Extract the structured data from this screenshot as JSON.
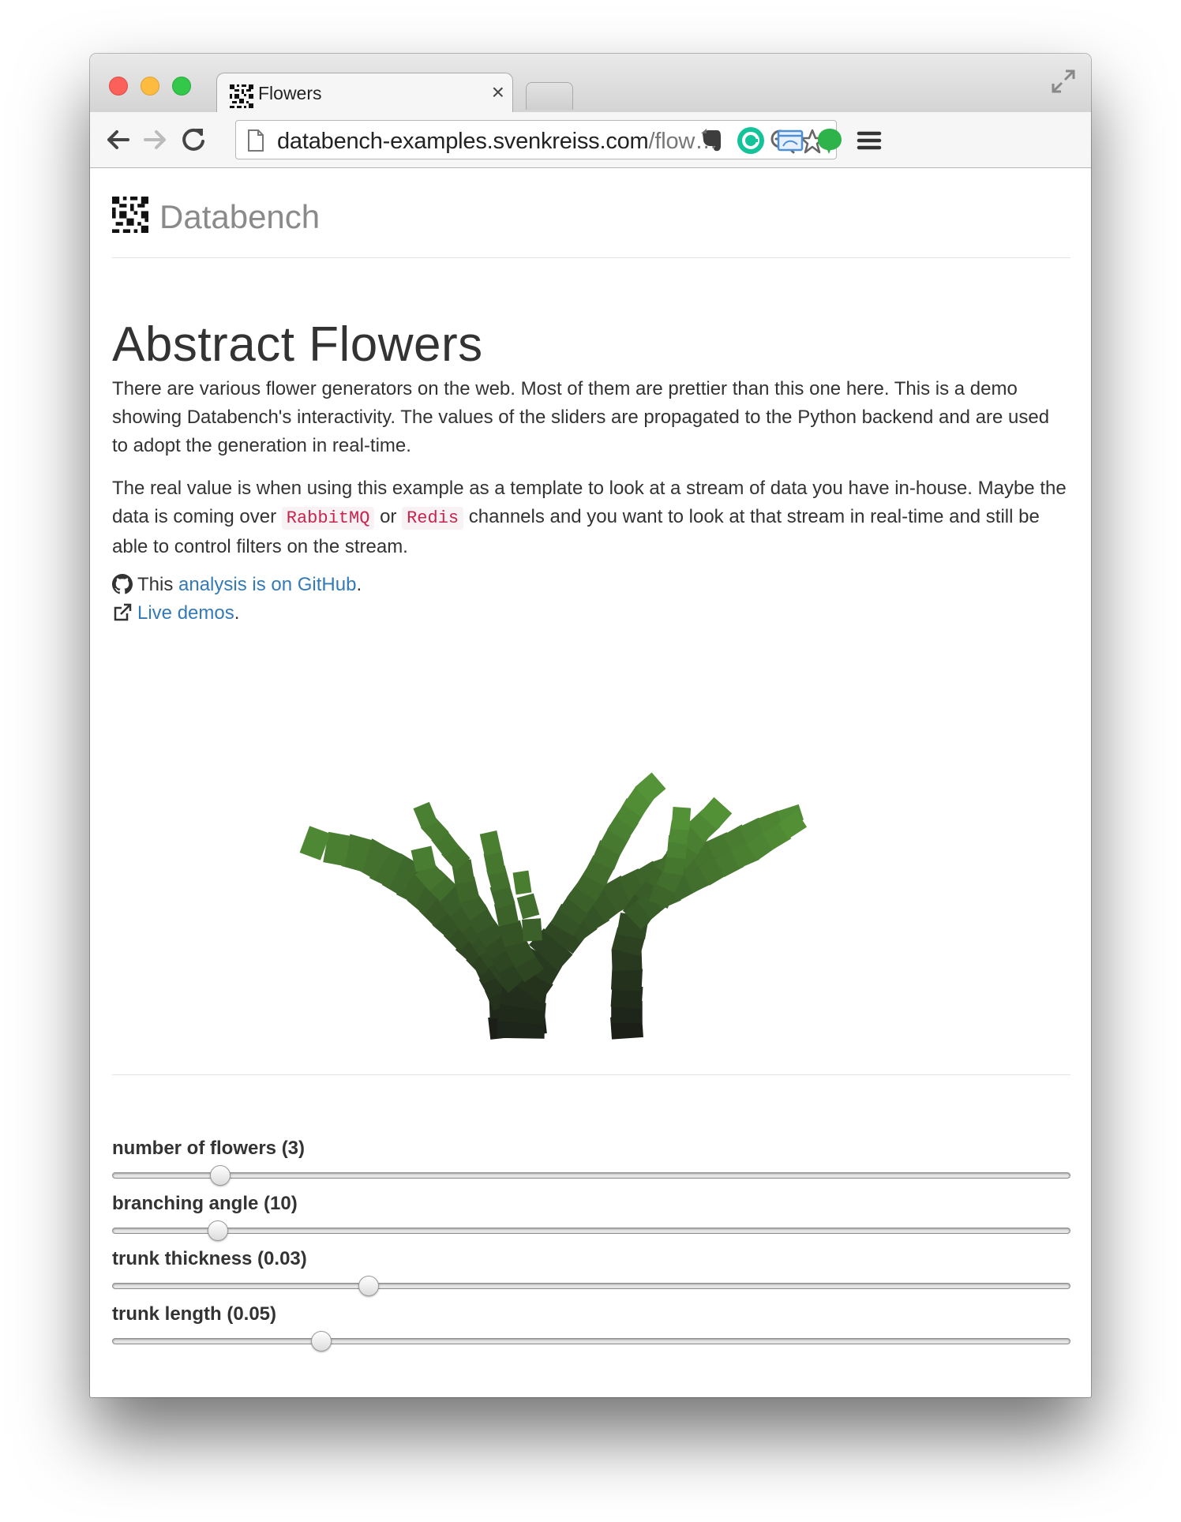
{
  "browser": {
    "tab_title": "Flowers",
    "tab_close": "×",
    "url_host": "databench-examples.svenkreiss.com",
    "url_rest": "/flow…"
  },
  "header": {
    "brand": "Databench"
  },
  "main": {
    "title": "Abstract Flowers",
    "para1": "There are various flower generators on the web. Most of them are prettier than this one here. This is a demo showing Databench's interactivity. The values of the sliders are propagated to the Python backend and are used to adopt the generation in real-time.",
    "para2_a": "The real value is when using this example as a template to look at a stream of data you have in-house. Maybe the data is coming over ",
    "para2_code1": "RabbitMQ",
    "para2_b": " or ",
    "para2_code2": "Redis",
    "para2_c": " channels and you want to look at that stream in real-time and still be able to control filters on the stream.",
    "github_prefix": "This ",
    "github_link": "analysis is on GitHub",
    "github_suffix": ".",
    "demos_link": "Live demos",
    "demos_suffix": "."
  },
  "sliders": [
    {
      "label": "number of flowers (3)",
      "fraction": 0.113
    },
    {
      "label": "branching angle (10)",
      "fraction": 0.11
    },
    {
      "label": "trunk thickness (0.03)",
      "fraction": 0.268
    },
    {
      "label": "trunk length (0.05)",
      "fraction": 0.218
    }
  ],
  "colors": {
    "link": "#337ab7",
    "code": "#c7254e",
    "flower_dark": "#1b1f18",
    "flower_light": "#5aa03a"
  }
}
